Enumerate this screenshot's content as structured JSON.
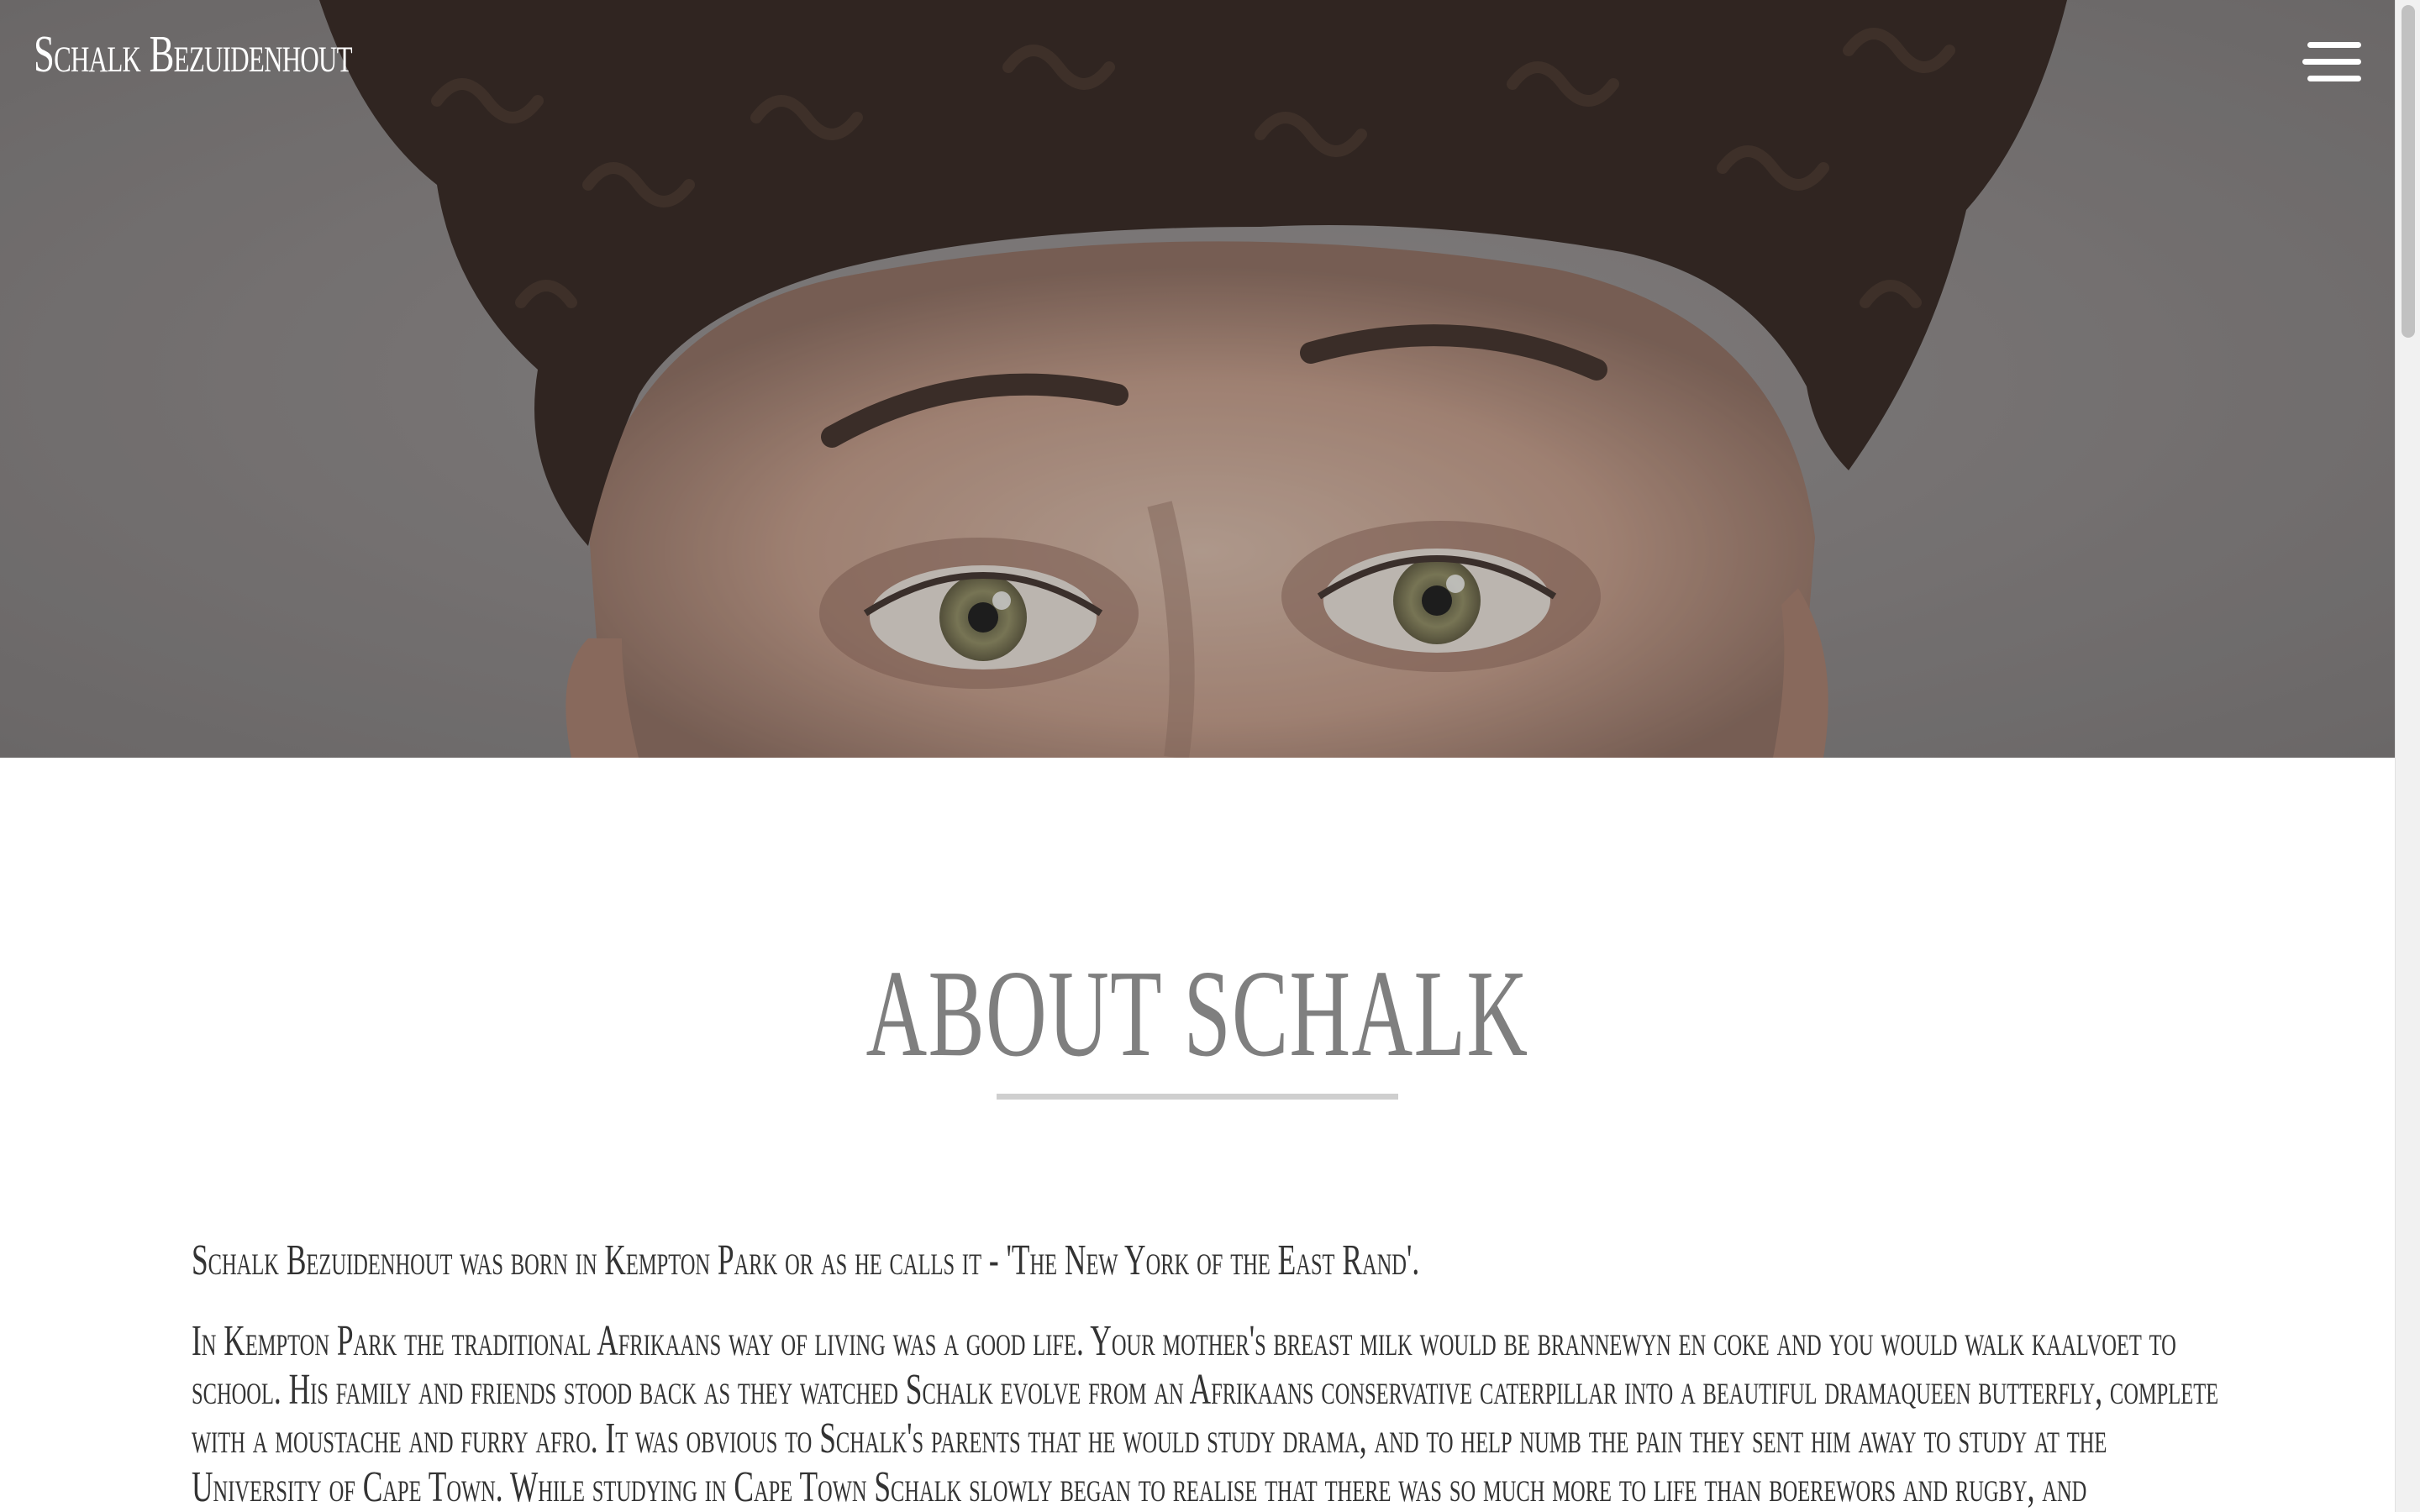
{
  "header": {
    "site_title": "Schalk Bezuidenhout",
    "menu_icon": "hamburger-menu-icon"
  },
  "hero": {
    "image_description_icon": "portrait-photo"
  },
  "about": {
    "title": "ABOUT SCHALK",
    "paragraphs": [
      "Schalk Bezuidenhout was born in Kempton Park or as he calls it - 'The New York of the East Rand'.",
      "In Kempton Park the traditional Afrikaans way of living was a good life. Your mother's breast milk would be brannewyn en coke and you would walk kaalvoet to school. His family and friends stood back as they watched Schalk evolve from an Afrikaans conservative caterpillar into a beautiful dramaqueen butterfly, complete with a moustache and furry afro. It was obvious to Schalk's parents that he would study drama, and to help numb the pain they sent him away to study at the University of Cape Town. While studying in Cape Town Schalk slowly began to realise that there was so much more to life than boerewors and rugby, and"
    ]
  },
  "colors": {
    "hero_overlay": "#3c3c3c",
    "title_text": "#7f7f7f",
    "rule": "#cfcfcf",
    "body_text": "#333333"
  }
}
